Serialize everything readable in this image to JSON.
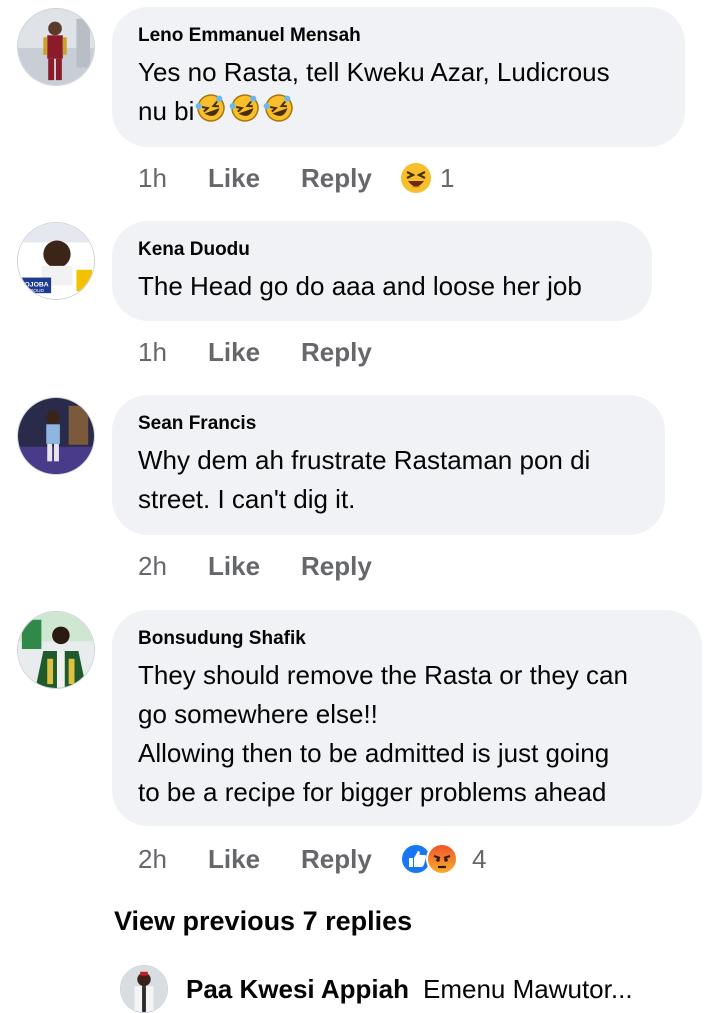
{
  "comments": [
    {
      "author": "Leno Emmanuel Mensah",
      "lines": [
        "Yes no Rasta, tell Kweku Azar, Ludicrous",
        "nu bi"
      ],
      "inline_emojis": [
        "rolling-laughing-emoji",
        "rolling-laughing-emoji",
        "rolling-laughing-emoji"
      ],
      "time": "1h",
      "like_label": "Like",
      "reply_label": "Reply",
      "reactions": [
        "laughing-squint-emoji"
      ],
      "reaction_count": "1"
    },
    {
      "author": "Kena Duodu",
      "lines": [
        "The Head go do aaa and loose her job"
      ],
      "time": "1h",
      "like_label": "Like",
      "reply_label": "Reply",
      "avatar_text": [
        "POJOBA",
        "& PROUD"
      ]
    },
    {
      "author": "Sean Francis",
      "lines": [
        "Why dem ah frustrate Rastaman pon di",
        "street. I can't dig it."
      ],
      "time": "2h",
      "like_label": "Like",
      "reply_label": "Reply"
    },
    {
      "author": "Bonsudung Shafik",
      "lines": [
        "They should remove the Rasta or they can",
        "go somewhere else!!",
        "Allowing then to be admitted is just going",
        "to be a recipe for bigger problems ahead"
      ],
      "time": "2h",
      "like_label": "Like",
      "reply_label": "Reply",
      "reactions": [
        "thumbs-up-reaction-icon",
        "angry-reaction-icon"
      ],
      "reaction_count": "4"
    }
  ],
  "view_previous": "View previous 7 replies",
  "latest_reply": {
    "author": "Paa Kwesi Appiah",
    "text": "Emenu Mawutor..."
  },
  "colors": {
    "bubble": "#f0f2f5",
    "secondary_text": "#65676b",
    "like_blue": "#1877f2",
    "angry_orange": "#e9710f"
  }
}
